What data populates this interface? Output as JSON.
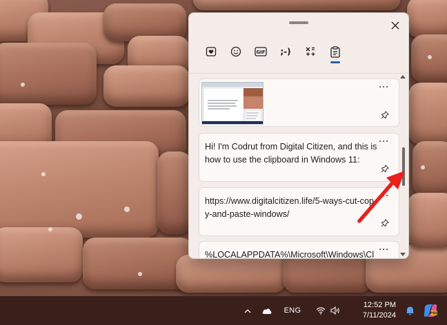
{
  "clipboard_panel": {
    "tabs": [
      {
        "name": "favorites",
        "icon": "heart-icon"
      },
      {
        "name": "emoji",
        "icon": "smiley-icon"
      },
      {
        "name": "gif",
        "label": "GIF"
      },
      {
        "name": "kaomoji",
        "label": ";-)"
      },
      {
        "name": "symbols",
        "icon": "symbols-icon"
      },
      {
        "name": "clipboard",
        "icon": "clipboard-icon",
        "active": true
      }
    ],
    "items": [
      {
        "type": "image",
        "more": "···"
      },
      {
        "type": "text",
        "text": "Hi! I'm Codrut from Digital Citizen, and this is how to use the clipboard in Windows 11:",
        "more": "···"
      },
      {
        "type": "text",
        "text": "https://www.digitalcitizen.life/5-ways-cut-copy-and-paste-windows/",
        "more": "···"
      },
      {
        "type": "text",
        "text": "%LOCALAPPDATA%\\Microsoft\\Windows\\Cl",
        "more": "···"
      }
    ]
  },
  "taskbar": {
    "language": "ENG",
    "time": "12:52 PM",
    "date": "7/11/2024"
  },
  "colors": {
    "accent": "#2b5fa8",
    "annotation_arrow": "#e8201e",
    "taskbar": "#3b1f1b"
  }
}
